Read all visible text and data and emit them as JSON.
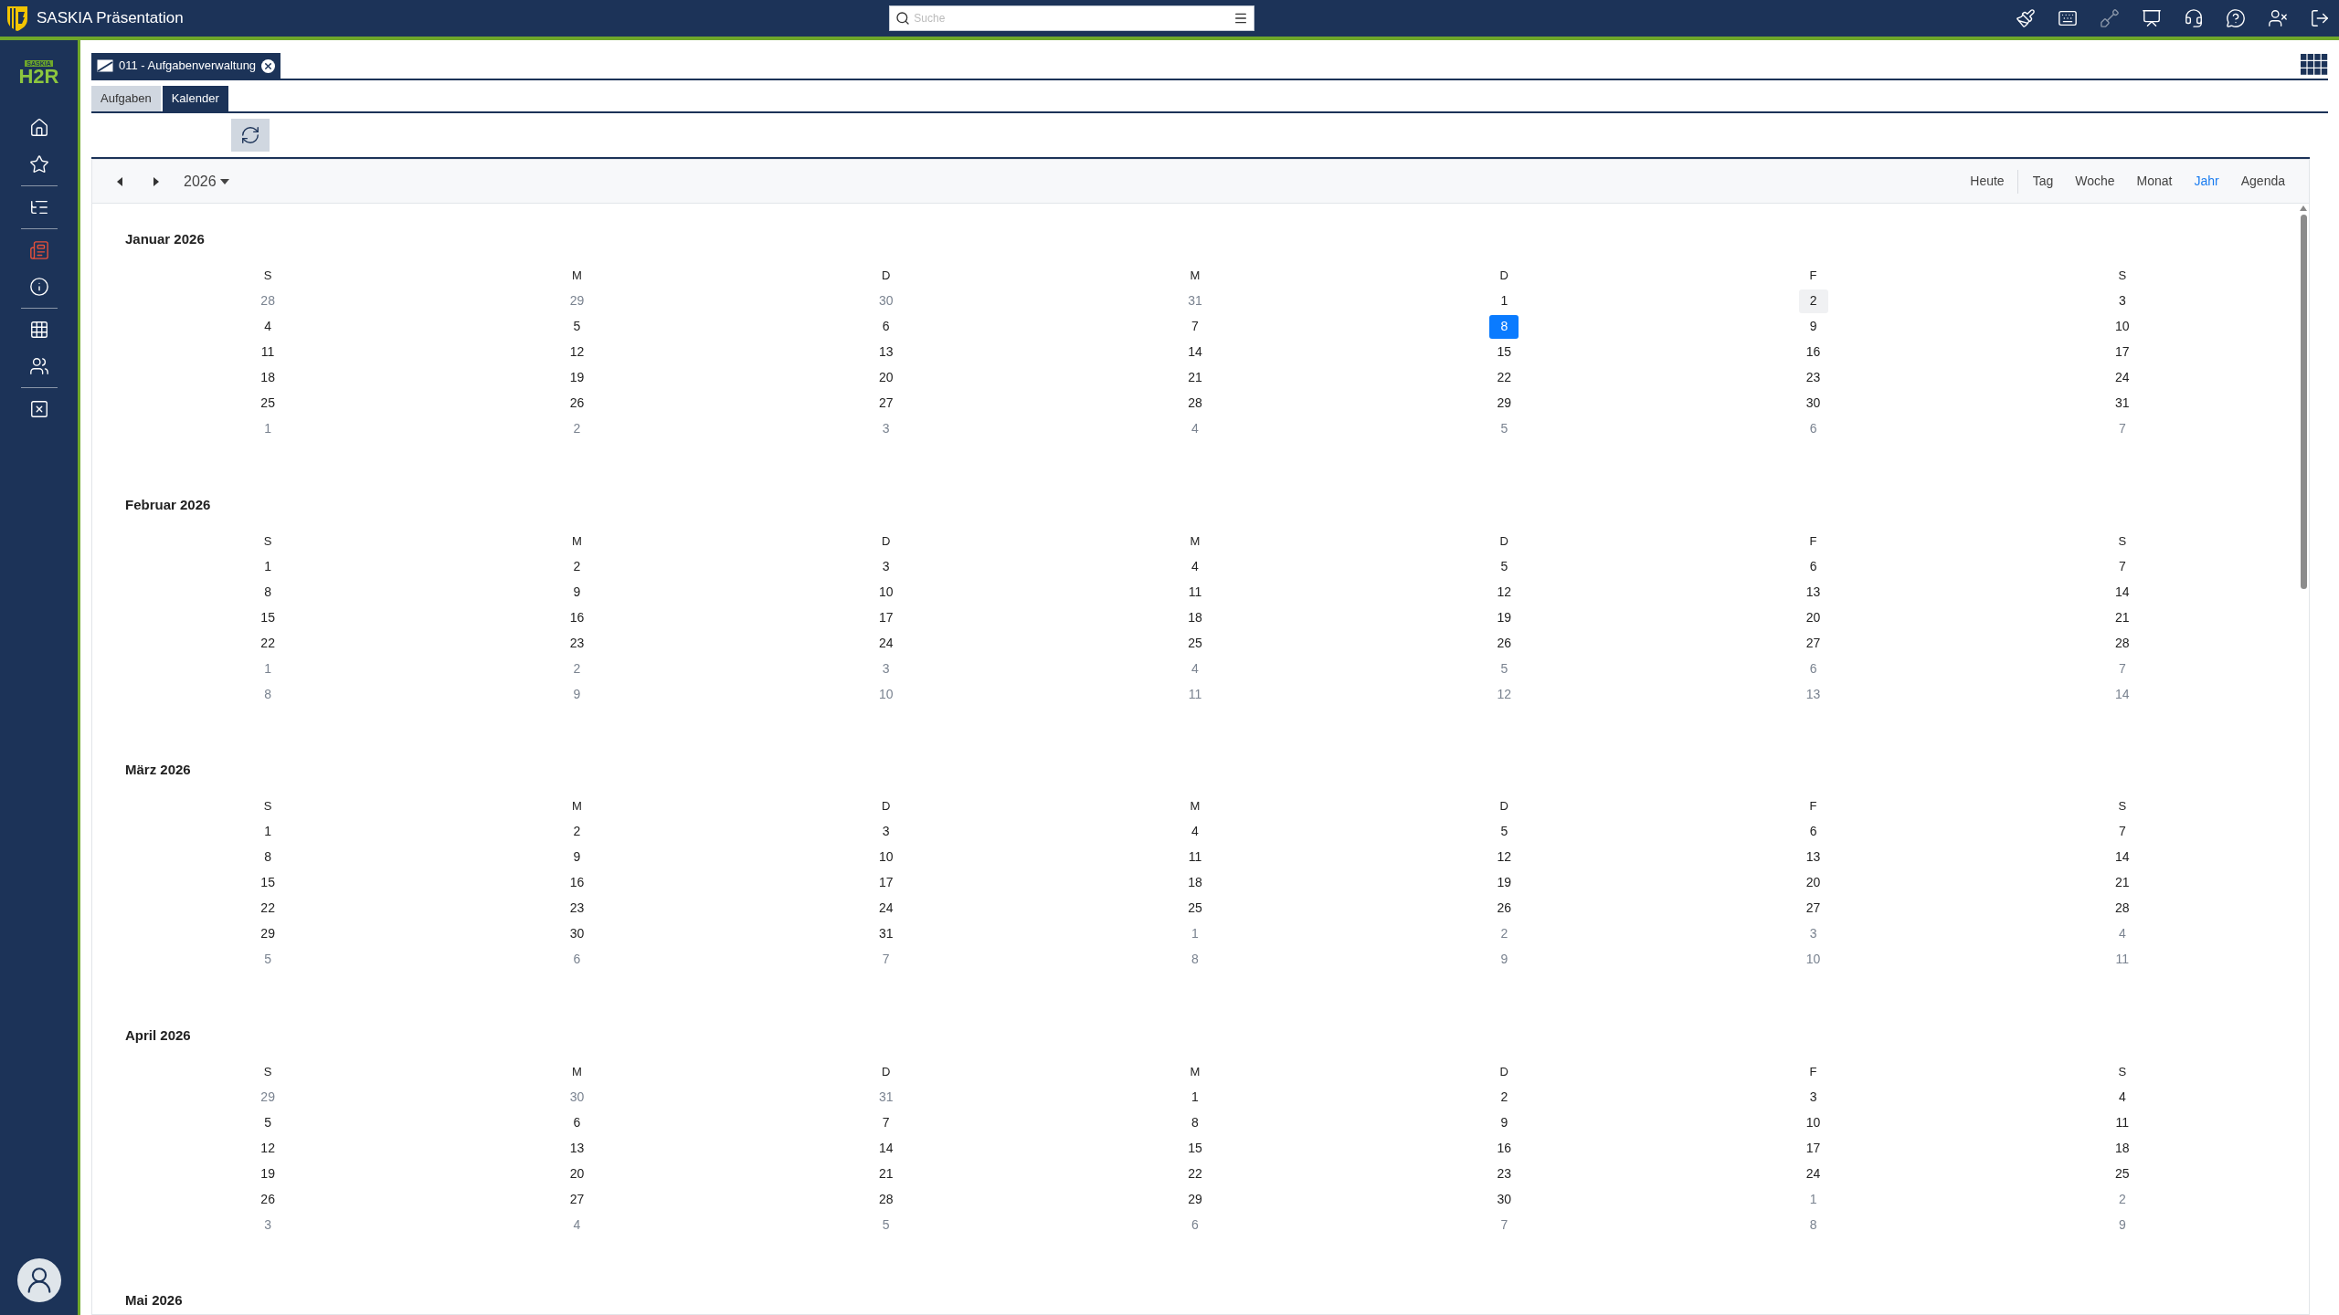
{
  "app": {
    "title": "SASKIA Präsentation",
    "search": {
      "placeholder": "Suche"
    },
    "actions": [
      {
        "disabled": false
      },
      {
        "disabled": false
      },
      {
        "disabled": true
      },
      {
        "disabled": false
      },
      {
        "disabled": false
      },
      {
        "disabled": false
      },
      {
        "disabled": false
      },
      {
        "disabled": false
      }
    ]
  },
  "sidebar": {
    "logo_small": "SASKIA",
    "logo": "H2R",
    "groups": [
      {
        "items": [
          {
            "selected": false
          },
          {
            "selected": false
          }
        ]
      },
      {
        "items": [
          {
            "selected": false
          }
        ]
      },
      {
        "items": [
          {
            "selected": true
          },
          {
            "selected": false
          }
        ]
      },
      {
        "items": [
          {
            "selected": false
          },
          {
            "selected": false
          }
        ]
      },
      {
        "items": [
          {
            "selected": false
          }
        ]
      }
    ]
  },
  "document_tabs": [
    {
      "label": "011 - Aufgabenverwaltung",
      "selected": true
    }
  ],
  "tabs": [
    {
      "label": "Aufgaben",
      "selected": false
    },
    {
      "label": "Kalender",
      "selected": true
    }
  ],
  "calendar": {
    "year": "2026",
    "views_today": "Heute",
    "views": [
      {
        "label": "Tag",
        "selected": false
      },
      {
        "label": "Woche",
        "selected": false
      },
      {
        "label": "Monat",
        "selected": false
      },
      {
        "label": "Jahr",
        "selected": true
      },
      {
        "label": "Agenda",
        "selected": false
      }
    ],
    "months": [
      {
        "title": "Januar 2026",
        "weekdays": [
          "S",
          "M",
          "D",
          "M",
          "D",
          "F",
          "S"
        ],
        "weeks": [
          [
            {
              "day": "28",
              "outside": true,
              "selected": false,
              "hovered": false
            },
            {
              "day": "29",
              "outside": true,
              "selected": false,
              "hovered": false
            },
            {
              "day": "30",
              "outside": true,
              "selected": false,
              "hovered": false
            },
            {
              "day": "31",
              "outside": true,
              "selected": false,
              "hovered": false
            },
            {
              "day": "1",
              "outside": false,
              "selected": false,
              "hovered": false
            },
            {
              "day": "2",
              "outside": false,
              "selected": false,
              "hovered": true
            },
            {
              "day": "3",
              "outside": false,
              "selected": false,
              "hovered": false
            }
          ],
          [
            {
              "day": "4",
              "outside": false,
              "selected": false,
              "hovered": false
            },
            {
              "day": "5",
              "outside": false,
              "selected": false,
              "hovered": false
            },
            {
              "day": "6",
              "outside": false,
              "selected": false,
              "hovered": false
            },
            {
              "day": "7",
              "outside": false,
              "selected": false,
              "hovered": false
            },
            {
              "day": "8",
              "outside": false,
              "selected": true,
              "hovered": false
            },
            {
              "day": "9",
              "outside": false,
              "selected": false,
              "hovered": false
            },
            {
              "day": "10",
              "outside": false,
              "selected": false,
              "hovered": false
            }
          ],
          [
            {
              "day": "11",
              "outside": false,
              "selected": false,
              "hovered": false
            },
            {
              "day": "12",
              "outside": false,
              "selected": false,
              "hovered": false
            },
            {
              "day": "13",
              "outside": false,
              "selected": false,
              "hovered": false
            },
            {
              "day": "14",
              "outside": false,
              "selected": false,
              "hovered": false
            },
            {
              "day": "15",
              "outside": false,
              "selected": false,
              "hovered": false
            },
            {
              "day": "16",
              "outside": false,
              "selected": false,
              "hovered": false
            },
            {
              "day": "17",
              "outside": false,
              "selected": false,
              "hovered": false
            }
          ],
          [
            {
              "day": "18",
              "outside": false,
              "selected": false,
              "hovered": false
            },
            {
              "day": "19",
              "outside": false,
              "selected": false,
              "hovered": false
            },
            {
              "day": "20",
              "outside": false,
              "selected": false,
              "hovered": false
            },
            {
              "day": "21",
              "outside": false,
              "selected": false,
              "hovered": false
            },
            {
              "day": "22",
              "outside": false,
              "selected": false,
              "hovered": false
            },
            {
              "day": "23",
              "outside": false,
              "selected": false,
              "hovered": false
            },
            {
              "day": "24",
              "outside": false,
              "selected": false,
              "hovered": false
            }
          ],
          [
            {
              "day": "25",
              "outside": false,
              "selected": false,
              "hovered": false
            },
            {
              "day": "26",
              "outside": false,
              "selected": false,
              "hovered": false
            },
            {
              "day": "27",
              "outside": false,
              "selected": false,
              "hovered": false
            },
            {
              "day": "28",
              "outside": false,
              "selected": false,
              "hovered": false
            },
            {
              "day": "29",
              "outside": false,
              "selected": false,
              "hovered": false
            },
            {
              "day": "30",
              "outside": false,
              "selected": false,
              "hovered": false
            },
            {
              "day": "31",
              "outside": false,
              "selected": false,
              "hovered": false
            }
          ],
          [
            {
              "day": "1",
              "outside": true,
              "selected": false,
              "hovered": false
            },
            {
              "day": "2",
              "outside": true,
              "selected": false,
              "hovered": false
            },
            {
              "day": "3",
              "outside": true,
              "selected": false,
              "hovered": false
            },
            {
              "day": "4",
              "outside": true,
              "selected": false,
              "hovered": false
            },
            {
              "day": "5",
              "outside": true,
              "selected": false,
              "hovered": false
            },
            {
              "day": "6",
              "outside": true,
              "selected": false,
              "hovered": false
            },
            {
              "day": "7",
              "outside": true,
              "selected": false,
              "hovered": false
            }
          ]
        ]
      },
      {
        "title": "Februar 2026",
        "weekdays": [
          "S",
          "M",
          "D",
          "M",
          "D",
          "F",
          "S"
        ],
        "weeks": [
          [
            {
              "day": "1",
              "outside": false,
              "selected": false,
              "hovered": false
            },
            {
              "day": "2",
              "outside": false,
              "selected": false,
              "hovered": false
            },
            {
              "day": "3",
              "outside": false,
              "selected": false,
              "hovered": false
            },
            {
              "day": "4",
              "outside": false,
              "selected": false,
              "hovered": false
            },
            {
              "day": "5",
              "outside": false,
              "selected": false,
              "hovered": false
            },
            {
              "day": "6",
              "outside": false,
              "selected": false,
              "hovered": false
            },
            {
              "day": "7",
              "outside": false,
              "selected": false,
              "hovered": false
            }
          ],
          [
            {
              "day": "8",
              "outside": false,
              "selected": false,
              "hovered": false
            },
            {
              "day": "9",
              "outside": false,
              "selected": false,
              "hovered": false
            },
            {
              "day": "10",
              "outside": false,
              "selected": false,
              "hovered": false
            },
            {
              "day": "11",
              "outside": false,
              "selected": false,
              "hovered": false
            },
            {
              "day": "12",
              "outside": false,
              "selected": false,
              "hovered": false
            },
            {
              "day": "13",
              "outside": false,
              "selected": false,
              "hovered": false
            },
            {
              "day": "14",
              "outside": false,
              "selected": false,
              "hovered": false
            }
          ],
          [
            {
              "day": "15",
              "outside": false,
              "selected": false,
              "hovered": false
            },
            {
              "day": "16",
              "outside": false,
              "selected": false,
              "hovered": false
            },
            {
              "day": "17",
              "outside": false,
              "selected": false,
              "hovered": false
            },
            {
              "day": "18",
              "outside": false,
              "selected": false,
              "hovered": false
            },
            {
              "day": "19",
              "outside": false,
              "selected": false,
              "hovered": false
            },
            {
              "day": "20",
              "outside": false,
              "selected": false,
              "hovered": false
            },
            {
              "day": "21",
              "outside": false,
              "selected": false,
              "hovered": false
            }
          ],
          [
            {
              "day": "22",
              "outside": false,
              "selected": false,
              "hovered": false
            },
            {
              "day": "23",
              "outside": false,
              "selected": false,
              "hovered": false
            },
            {
              "day": "24",
              "outside": false,
              "selected": false,
              "hovered": false
            },
            {
              "day": "25",
              "outside": false,
              "selected": false,
              "hovered": false
            },
            {
              "day": "26",
              "outside": false,
              "selected": false,
              "hovered": false
            },
            {
              "day": "27",
              "outside": false,
              "selected": false,
              "hovered": false
            },
            {
              "day": "28",
              "outside": false,
              "selected": false,
              "hovered": false
            }
          ],
          [
            {
              "day": "1",
              "outside": true,
              "selected": false,
              "hovered": false
            },
            {
              "day": "2",
              "outside": true,
              "selected": false,
              "hovered": false
            },
            {
              "day": "3",
              "outside": true,
              "selected": false,
              "hovered": false
            },
            {
              "day": "4",
              "outside": true,
              "selected": false,
              "hovered": false
            },
            {
              "day": "5",
              "outside": true,
              "selected": false,
              "hovered": false
            },
            {
              "day": "6",
              "outside": true,
              "selected": false,
              "hovered": false
            },
            {
              "day": "7",
              "outside": true,
              "selected": false,
              "hovered": false
            }
          ],
          [
            {
              "day": "8",
              "outside": true,
              "selected": false,
              "hovered": false
            },
            {
              "day": "9",
              "outside": true,
              "selected": false,
              "hovered": false
            },
            {
              "day": "10",
              "outside": true,
              "selected": false,
              "hovered": false
            },
            {
              "day": "11",
              "outside": true,
              "selected": false,
              "hovered": false
            },
            {
              "day": "12",
              "outside": true,
              "selected": false,
              "hovered": false
            },
            {
              "day": "13",
              "outside": true,
              "selected": false,
              "hovered": false
            },
            {
              "day": "14",
              "outside": true,
              "selected": false,
              "hovered": false
            }
          ]
        ]
      },
      {
        "title": "März 2026",
        "weekdays": [
          "S",
          "M",
          "D",
          "M",
          "D",
          "F",
          "S"
        ],
        "weeks": [
          [
            {
              "day": "1",
              "outside": false,
              "selected": false,
              "hovered": false
            },
            {
              "day": "2",
              "outside": false,
              "selected": false,
              "hovered": false
            },
            {
              "day": "3",
              "outside": false,
              "selected": false,
              "hovered": false
            },
            {
              "day": "4",
              "outside": false,
              "selected": false,
              "hovered": false
            },
            {
              "day": "5",
              "outside": false,
              "selected": false,
              "hovered": false
            },
            {
              "day": "6",
              "outside": false,
              "selected": false,
              "hovered": false
            },
            {
              "day": "7",
              "outside": false,
              "selected": false,
              "hovered": false
            }
          ],
          [
            {
              "day": "8",
              "outside": false,
              "selected": false,
              "hovered": false
            },
            {
              "day": "9",
              "outside": false,
              "selected": false,
              "hovered": false
            },
            {
              "day": "10",
              "outside": false,
              "selected": false,
              "hovered": false
            },
            {
              "day": "11",
              "outside": false,
              "selected": false,
              "hovered": false
            },
            {
              "day": "12",
              "outside": false,
              "selected": false,
              "hovered": false
            },
            {
              "day": "13",
              "outside": false,
              "selected": false,
              "hovered": false
            },
            {
              "day": "14",
              "outside": false,
              "selected": false,
              "hovered": false
            }
          ],
          [
            {
              "day": "15",
              "outside": false,
              "selected": false,
              "hovered": false
            },
            {
              "day": "16",
              "outside": false,
              "selected": false,
              "hovered": false
            },
            {
              "day": "17",
              "outside": false,
              "selected": false,
              "hovered": false
            },
            {
              "day": "18",
              "outside": false,
              "selected": false,
              "hovered": false
            },
            {
              "day": "19",
              "outside": false,
              "selected": false,
              "hovered": false
            },
            {
              "day": "20",
              "outside": false,
              "selected": false,
              "hovered": false
            },
            {
              "day": "21",
              "outside": false,
              "selected": false,
              "hovered": false
            }
          ],
          [
            {
              "day": "22",
              "outside": false,
              "selected": false,
              "hovered": false
            },
            {
              "day": "23",
              "outside": false,
              "selected": false,
              "hovered": false
            },
            {
              "day": "24",
              "outside": false,
              "selected": false,
              "hovered": false
            },
            {
              "day": "25",
              "outside": false,
              "selected": false,
              "hovered": false
            },
            {
              "day": "26",
              "outside": false,
              "selected": false,
              "hovered": false
            },
            {
              "day": "27",
              "outside": false,
              "selected": false,
              "hovered": false
            },
            {
              "day": "28",
              "outside": false,
              "selected": false,
              "hovered": false
            }
          ],
          [
            {
              "day": "29",
              "outside": false,
              "selected": false,
              "hovered": false
            },
            {
              "day": "30",
              "outside": false,
              "selected": false,
              "hovered": false
            },
            {
              "day": "31",
              "outside": false,
              "selected": false,
              "hovered": false
            },
            {
              "day": "1",
              "outside": true,
              "selected": false,
              "hovered": false
            },
            {
              "day": "2",
              "outside": true,
              "selected": false,
              "hovered": false
            },
            {
              "day": "3",
              "outside": true,
              "selected": false,
              "hovered": false
            },
            {
              "day": "4",
              "outside": true,
              "selected": false,
              "hovered": false
            }
          ],
          [
            {
              "day": "5",
              "outside": true,
              "selected": false,
              "hovered": false
            },
            {
              "day": "6",
              "outside": true,
              "selected": false,
              "hovered": false
            },
            {
              "day": "7",
              "outside": true,
              "selected": false,
              "hovered": false
            },
            {
              "day": "8",
              "outside": true,
              "selected": false,
              "hovered": false
            },
            {
              "day": "9",
              "outside": true,
              "selected": false,
              "hovered": false
            },
            {
              "day": "10",
              "outside": true,
              "selected": false,
              "hovered": false
            },
            {
              "day": "11",
              "outside": true,
              "selected": false,
              "hovered": false
            }
          ]
        ]
      },
      {
        "title": "April 2026",
        "weekdays": [
          "S",
          "M",
          "D",
          "M",
          "D",
          "F",
          "S"
        ],
        "weeks": [
          [
            {
              "day": "29",
              "outside": true,
              "selected": false,
              "hovered": false
            },
            {
              "day": "30",
              "outside": true,
              "selected": false,
              "hovered": false
            },
            {
              "day": "31",
              "outside": true,
              "selected": false,
              "hovered": false
            },
            {
              "day": "1",
              "outside": false,
              "selected": false,
              "hovered": false
            },
            {
              "day": "2",
              "outside": false,
              "selected": false,
              "hovered": false
            },
            {
              "day": "3",
              "outside": false,
              "selected": false,
              "hovered": false
            },
            {
              "day": "4",
              "outside": false,
              "selected": false,
              "hovered": false
            }
          ],
          [
            {
              "day": "5",
              "outside": false,
              "selected": false,
              "hovered": false
            },
            {
              "day": "6",
              "outside": false,
              "selected": false,
              "hovered": false
            },
            {
              "day": "7",
              "outside": false,
              "selected": false,
              "hovered": false
            },
            {
              "day": "8",
              "outside": false,
              "selected": false,
              "hovered": false
            },
            {
              "day": "9",
              "outside": false,
              "selected": false,
              "hovered": false
            },
            {
              "day": "10",
              "outside": false,
              "selected": false,
              "hovered": false
            },
            {
              "day": "11",
              "outside": false,
              "selected": false,
              "hovered": false
            }
          ],
          [
            {
              "day": "12",
              "outside": false,
              "selected": false,
              "hovered": false
            },
            {
              "day": "13",
              "outside": false,
              "selected": false,
              "hovered": false
            },
            {
              "day": "14",
              "outside": false,
              "selected": false,
              "hovered": false
            },
            {
              "day": "15",
              "outside": false,
              "selected": false,
              "hovered": false
            },
            {
              "day": "16",
              "outside": false,
              "selected": false,
              "hovered": false
            },
            {
              "day": "17",
              "outside": false,
              "selected": false,
              "hovered": false
            },
            {
              "day": "18",
              "outside": false,
              "selected": false,
              "hovered": false
            }
          ],
          [
            {
              "day": "19",
              "outside": false,
              "selected": false,
              "hovered": false
            },
            {
              "day": "20",
              "outside": false,
              "selected": false,
              "hovered": false
            },
            {
              "day": "21",
              "outside": false,
              "selected": false,
              "hovered": false
            },
            {
              "day": "22",
              "outside": false,
              "selected": false,
              "hovered": false
            },
            {
              "day": "23",
              "outside": false,
              "selected": false,
              "hovered": false
            },
            {
              "day": "24",
              "outside": false,
              "selected": false,
              "hovered": false
            },
            {
              "day": "25",
              "outside": false,
              "selected": false,
              "hovered": false
            }
          ],
          [
            {
              "day": "26",
              "outside": false,
              "selected": false,
              "hovered": false
            },
            {
              "day": "27",
              "outside": false,
              "selected": false,
              "hovered": false
            },
            {
              "day": "28",
              "outside": false,
              "selected": false,
              "hovered": false
            },
            {
              "day": "29",
              "outside": false,
              "selected": false,
              "hovered": false
            },
            {
              "day": "30",
              "outside": false,
              "selected": false,
              "hovered": false
            },
            {
              "day": "1",
              "outside": true,
              "selected": false,
              "hovered": false
            },
            {
              "day": "2",
              "outside": true,
              "selected": false,
              "hovered": false
            }
          ],
          [
            {
              "day": "3",
              "outside": true,
              "selected": false,
              "hovered": false
            },
            {
              "day": "4",
              "outside": true,
              "selected": false,
              "hovered": false
            },
            {
              "day": "5",
              "outside": true,
              "selected": false,
              "hovered": false
            },
            {
              "day": "6",
              "outside": true,
              "selected": false,
              "hovered": false
            },
            {
              "day": "7",
              "outside": true,
              "selected": false,
              "hovered": false
            },
            {
              "day": "8",
              "outside": true,
              "selected": false,
              "hovered": false
            },
            {
              "day": "9",
              "outside": true,
              "selected": false,
              "hovered": false
            }
          ]
        ]
      },
      {
        "title": "Mai 2026"
      }
    ]
  }
}
